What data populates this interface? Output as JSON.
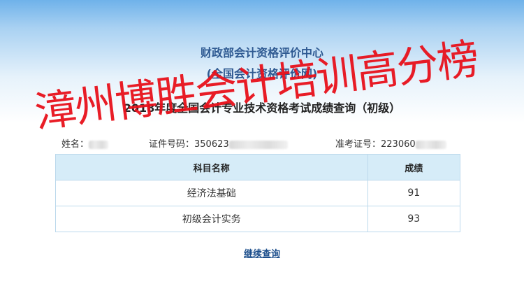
{
  "header": {
    "org_title": "财政部会计资格评价中心",
    "org_subtitle": "(全国会计资格评价网)",
    "result_title": "2018年度全国会计专业技术资格考试成绩查询（初级）"
  },
  "info": {
    "name_label": "姓名：",
    "id_label": "证件号码：",
    "id_visible": "350623",
    "exam_label": "准考证号：",
    "exam_visible": "223060"
  },
  "table": {
    "headers": [
      "科目名称",
      "成绩"
    ],
    "rows": [
      {
        "subject": "经济法基础",
        "score": "91"
      },
      {
        "subject": "初级会计实务",
        "score": "93"
      }
    ]
  },
  "actions": {
    "continue_label": "继续查询"
  },
  "watermark": {
    "text": "漳州博胜会计培训高分榜"
  },
  "colors": {
    "title_blue": "#2f5a92",
    "header_bg": "#d6ecf8",
    "border": "#bcd9ec",
    "watermark_red": "#e8111b"
  }
}
